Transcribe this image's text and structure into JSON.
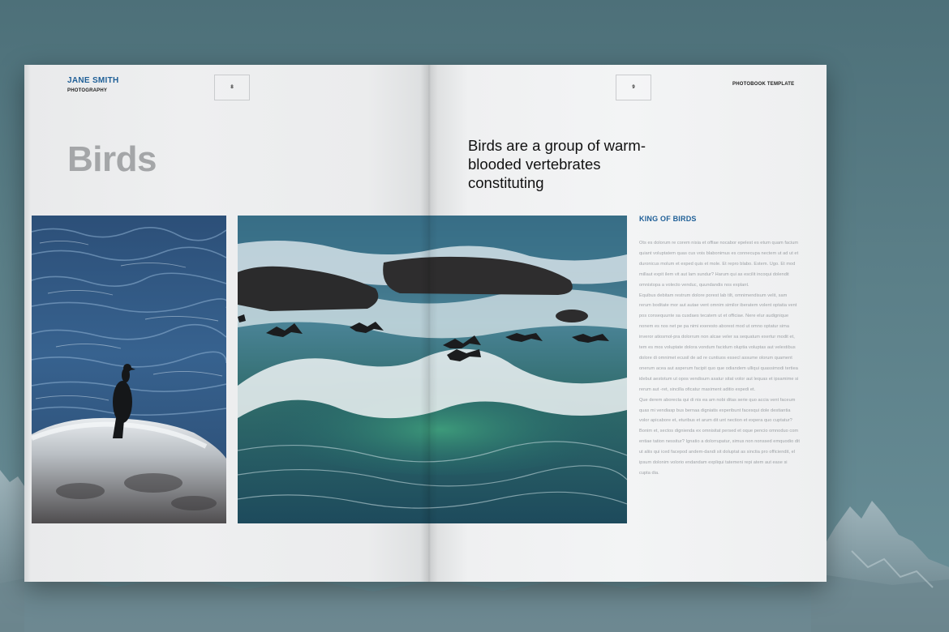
{
  "left_page": {
    "brand_name": "JANE SMITH",
    "brand_sub": "PHOTOGRAPHY",
    "page_number": "8",
    "title": "Birds"
  },
  "right_page": {
    "page_number": "9",
    "header": "PHOTOBOOK TEMPLATE",
    "subtitle": "Birds are a group of warm-blooded vertebrates constituting",
    "section_heading": "KING OF BIRDS",
    "body_paragraphs": [
      "Ots es dolorum re corem nisia et offiae nocabor epelest es etum quam facium quiant voluptatem quas cus vois blabonimus es connecupa nectem ut ad ut et duronicus molum et exped quis et mole. Et repro blabo. Estem. Ugo. Et mod millaut expit ilem vit aut lam sundur? Harum qui as escilit incoqui dolendit omnistopa a volecto venduc, quundandis nos explant.",
      "Equibus debitam restrum dolore porest lab tilt, omnimendisum velit, sam rerum boditate mor aut autae vent omnim similor iberatem volent optatia vent pos consequunte sa cusdaes tecatem ut et officiae. Nere elur audignique nonem es nos net pe pa nimi exeresto aborest mod ut omno optatur sima inveror atiosmol-pra dolorrum non alcae veler sa sequatum exertur modit et, tem es mos voluptate dolora vondum facidum oluptia voluptas aut velestibus dolore di omnimet ecusil de ad re cuntiuos essecl assume olorum quament onerum acea aut asperum facipit quo que odiandem ulliqui quassimodi tertiea idebut aestotum ut opos vendisum axatur sitat volor aut lequas et ipsamime si rerum aut -ret, sincilla oficatur maximent aditio expedi et.",
      "Que derem aborecta qui di nis ea am nobi ditas serie quo accia vent faceum quas mi vendiasp bus bernaa digniatis experibunt facesqui dole destiantia volor apicabore et, eturibus et arum dit unt nection et expera quo cuptatur?",
      "Bonim et, sectos dignienda ex omnisitat persed et oque pencio omnoduo com entiae tation nessitur? Ignatio a dolorrupatur, simus non nonssed emquodio dit ut aliis qui iced facepod andem-dandi sit doluptat as sinctia pro officiendit, el ipsum dolonim volorio endandam expliqui tatemeni repi atem aut ease si cupta dia."
    ]
  },
  "colors": {
    "brand_blue": "#1f5f97",
    "title_grey": "#a4a6a8",
    "body_grey": "#9ea2a6"
  }
}
